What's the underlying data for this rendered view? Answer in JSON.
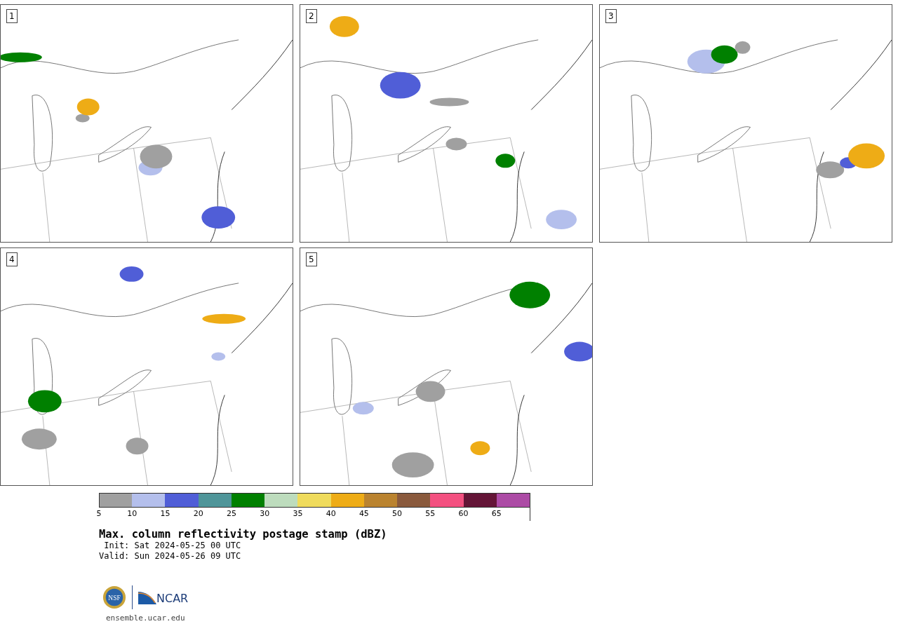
{
  "panels": [
    {
      "number": "1"
    },
    {
      "number": "2"
    },
    {
      "number": "3"
    },
    {
      "number": "4"
    },
    {
      "number": "5"
    }
  ],
  "colorbar": {
    "segments": [
      {
        "color": "#a0a0a0",
        "tick": "5"
      },
      {
        "color": "#b4bfec",
        "tick": "10"
      },
      {
        "color": "#505ed7",
        "tick": "15"
      },
      {
        "color": "#4f9599",
        "tick": "20"
      },
      {
        "color": "#008000",
        "tick": "25"
      },
      {
        "color": "#bddcbd",
        "tick": "30"
      },
      {
        "color": "#efdb5c",
        "tick": "35"
      },
      {
        "color": "#eeac16",
        "tick": "40"
      },
      {
        "color": "#ba832f",
        "tick": "45"
      },
      {
        "color": "#8a5a3d",
        "tick": "50"
      },
      {
        "color": "#f35080",
        "tick": "55"
      },
      {
        "color": "#641537",
        "tick": "60"
      },
      {
        "color": "#ac4ba5",
        "tick": "65"
      }
    ]
  },
  "title": "Max. column reflectivity postage stamp (dBZ)",
  "init": " Init: Sat 2024-05-25 00 UTC",
  "valid": "Valid: Sun 2024-05-26 09 UTC",
  "logo": {
    "seal_text": "NSF",
    "wordmark": "NCAR"
  },
  "footer": "ensemble.ucar.edu"
}
